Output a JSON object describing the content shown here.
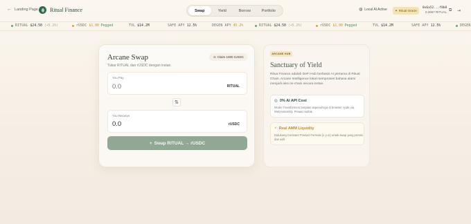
{
  "header": {
    "back_link": "Landing Page",
    "brand": "Ritual Finance",
    "nav": [
      {
        "label": "Swap",
        "active": true
      },
      {
        "label": "Yield",
        "active": false
      },
      {
        "label": "Borrow",
        "active": false
      },
      {
        "label": "Portfolio",
        "active": false
      }
    ],
    "ai_status": "Local AI Active",
    "oracle_button": "Ritual Oracle",
    "wallet_address": "0x6a52...f8b8",
    "wallet_balance": "0.2667 RITUAL"
  },
  "ticker": [
    {
      "label": "RITUAL",
      "value": "$24.50",
      "change": "(+5.2%)",
      "dot": "green"
    },
    {
      "label": "rUSDC",
      "value": "$1.00",
      "change": "Pegged",
      "dot": "amber"
    },
    {
      "label": "TVL",
      "value": "$14.2M",
      "change": "",
      "dot": ""
    },
    {
      "label": "SAFE APY",
      "value": "12.5%",
      "change": "",
      "dot": ""
    },
    {
      "label": "DEGEN APY",
      "value": "45.2%",
      "change": "",
      "dot": ""
    },
    {
      "label": "RITUAL",
      "value": "$24.50",
      "change": "(+5.2%)",
      "dot": "green"
    },
    {
      "label": "rUSDC",
      "value": "$1.00",
      "change": "Pegged",
      "dot": "amber"
    },
    {
      "label": "TVL",
      "value": "$14.2M",
      "change": "",
      "dot": ""
    },
    {
      "label": "SAFE APY",
      "value": "12.5%",
      "change": "",
      "dot": ""
    },
    {
      "label": "DEGEN",
      "value": "",
      "change": "",
      "dot": "green"
    }
  ],
  "swap": {
    "title": "Arcane Swap",
    "subtitle": "Tukar RITUAL dan rUSDC dengan instan.",
    "claim_label": "Claim 1000 rUSDC",
    "pay": {
      "label": "You Pay",
      "placeholder": "0.0",
      "token": "RITUAL"
    },
    "receive": {
      "label": "You Receive",
      "value": "0.0",
      "token": "rUSDC"
    },
    "button_label": "Swap RITUAL → rUSDC",
    "button_icon": "+"
  },
  "yield": {
    "badge": "ARCANE HUB",
    "title": "Sanctuary of Yield",
    "description": "Ritua Finance adalah DeFi Hub berbasis AI pertama di Ritual Chain. Arcane Intelligence lokal memproses bahasa alami menjadi aksi on-chain secara instan.",
    "features": [
      {
        "title": "0% AI API Cost",
        "description": "Model Transformers berjalan sepenuhnya di browser Anda via WebAssembly. Privasi mutlak."
      },
      {
        "title": "Real AMM Liquidity",
        "description": "Didukung Constant Product Formula (x·y=k) untuk swap yang presisi dan adil."
      }
    ]
  },
  "colors": {
    "accent_green": "#2e6a4e",
    "swap_button": "#8fa995",
    "gold": "#c7902a"
  }
}
